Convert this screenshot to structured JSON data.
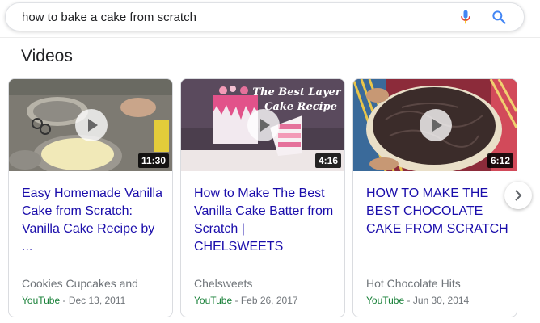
{
  "search": {
    "query": "how to bake a cake from scratch",
    "mic_icon": "microphone-icon",
    "search_icon": "magnifier-icon"
  },
  "section": {
    "title": "Videos"
  },
  "videos": [
    {
      "title": "Easy Homemade Vanilla Cake from Scratch: Vanilla Cake Recipe by ...",
      "duration": "11:30",
      "channel": "Cookies Cupcakes and",
      "source": "YouTube",
      "date": " - Dec 13, 2011"
    },
    {
      "title": "How to Make The Best Vanilla Cake Batter from Scratch | CHELSWEETS",
      "duration": "4:16",
      "thumbnail_text_line1": "The Best Layer",
      "thumbnail_text_line2": "Cake Recipe",
      "channel": "Chelsweets",
      "source": "YouTube",
      "date": " - Feb 26, 2017"
    },
    {
      "title": "HOW TO MAKE THE BEST CHOCOLATE CAKE FROM SCRATCH",
      "duration": "6:12",
      "channel": "Hot Chocolate Hits",
      "source": "YouTube",
      "date": " - Jun 30, 2014"
    }
  ],
  "carousel": {
    "next_icon": "chevron-right-icon"
  },
  "colors": {
    "link": "#1a0dab",
    "source": "#188038",
    "meta": "#70757a",
    "mic_red": "#ea4335",
    "mic_blue": "#4285f4"
  }
}
